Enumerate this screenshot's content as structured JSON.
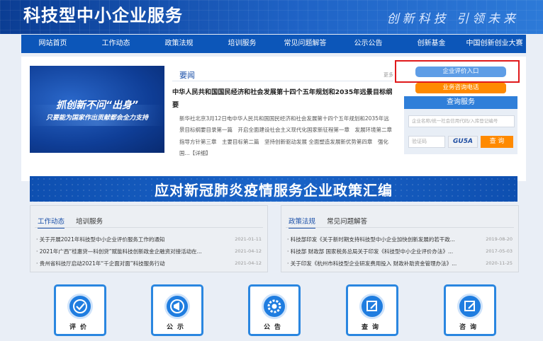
{
  "header": {
    "title": "科技型中小企业服务",
    "slogan": "创新科技 引领未来"
  },
  "nav": [
    "网站首页",
    "工作动态",
    "政策法规",
    "培训服务",
    "常见问题解答",
    "公示公告",
    "创新基金",
    "中国创新创业大赛"
  ],
  "banner": {
    "line1": "抓创新不问“出身”",
    "line2": "只要能为国家作出贡献都会全力支持"
  },
  "news": {
    "heading": "要闻",
    "more": "更多",
    "title": "中华人民共和国国民经济和社会发展第十四个五年规划和2035年远景目标纲要",
    "body": "新华社北京3月12日电中华人民共和国国民经济和社会发展第十四个五年规划和2035年远景目标纲要目录第一篇　开启全面建设社会主义现代化国家新征程第一章　发展环境第二章　指导方针第三章　主要目标第二篇　坚持创新驱动发展 全面塑造发展新优势第四章　强化国...【详细】"
  },
  "services": {
    "eval_entry": "企业评价入口",
    "hotline": "业务咨询电话",
    "query_title": "查询服务",
    "company_placeholder": "企业名称/统一社会信用代码/入库登记编号",
    "captcha_placeholder": "验证码",
    "captcha_code": "GU5A",
    "query_button": "查 询"
  },
  "policy_banner": "应对新冠肺炎疫情服务企业政策汇编",
  "left_panel": {
    "tabs": [
      "工作动态",
      "培训服务"
    ],
    "items": [
      {
        "text": "·  关于开展2021年科技型中小企业评价服务工作的通知",
        "date": "2021-01-11"
      },
      {
        "text": "·  2021年广西“桂惠贷—科创贷”赋能科技创新政金企融资对接活动在...",
        "date": "2021-04-12"
      },
      {
        "text": "·  贵州省科技厅启动2021年“千企面对面”科技服务行动",
        "date": "2021-04-12"
      }
    ]
  },
  "right_panel": {
    "tabs": [
      "政策法规",
      "常见问题解答"
    ],
    "items": [
      {
        "text": "·  科技部印发《关于新时期支持科技型中小企业加快创新发展的若干政...",
        "date": "2019-08-20"
      },
      {
        "text": "·  科技部 财政部 国家税务总局关于印发《科技型中小企业评价办法》...",
        "date": "2017-05-03"
      },
      {
        "text": "·  关于印发《杭州市科技型企业研发费用投入 财政补助资金管理办法》...",
        "date": "2020-11-25"
      }
    ]
  },
  "cards": [
    {
      "label": "评价",
      "icon": "check-circle-icon"
    },
    {
      "label": "公示",
      "icon": "bullhorn-icon"
    },
    {
      "label": "公告",
      "icon": "gear-icon"
    },
    {
      "label": "查询",
      "icon": "edit-icon"
    },
    {
      "label": "咨询",
      "icon": "edit-icon"
    }
  ]
}
